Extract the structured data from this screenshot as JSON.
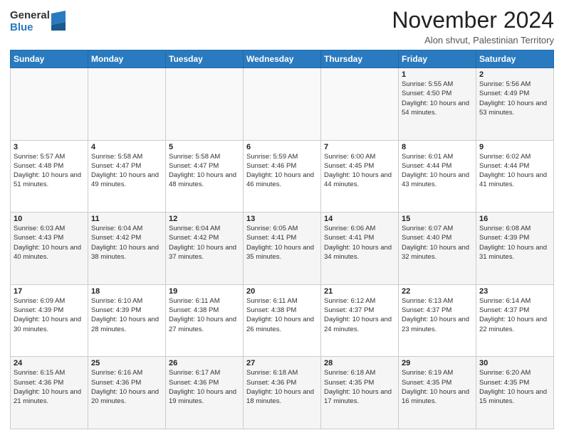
{
  "logo": {
    "general": "General",
    "blue": "Blue"
  },
  "header": {
    "title": "November 2024",
    "subtitle": "Alon shvut, Palestinian Territory"
  },
  "weekdays": [
    "Sunday",
    "Monday",
    "Tuesday",
    "Wednesday",
    "Thursday",
    "Friday",
    "Saturday"
  ],
  "weeks": [
    [
      {
        "day": "",
        "info": ""
      },
      {
        "day": "",
        "info": ""
      },
      {
        "day": "",
        "info": ""
      },
      {
        "day": "",
        "info": ""
      },
      {
        "day": "",
        "info": ""
      },
      {
        "day": "1",
        "info": "Sunrise: 5:55 AM\nSunset: 4:50 PM\nDaylight: 10 hours\nand 54 minutes."
      },
      {
        "day": "2",
        "info": "Sunrise: 5:56 AM\nSunset: 4:49 PM\nDaylight: 10 hours\nand 53 minutes."
      }
    ],
    [
      {
        "day": "3",
        "info": "Sunrise: 5:57 AM\nSunset: 4:48 PM\nDaylight: 10 hours\nand 51 minutes."
      },
      {
        "day": "4",
        "info": "Sunrise: 5:58 AM\nSunset: 4:47 PM\nDaylight: 10 hours\nand 49 minutes."
      },
      {
        "day": "5",
        "info": "Sunrise: 5:58 AM\nSunset: 4:47 PM\nDaylight: 10 hours\nand 48 minutes."
      },
      {
        "day": "6",
        "info": "Sunrise: 5:59 AM\nSunset: 4:46 PM\nDaylight: 10 hours\nand 46 minutes."
      },
      {
        "day": "7",
        "info": "Sunrise: 6:00 AM\nSunset: 4:45 PM\nDaylight: 10 hours\nand 44 minutes."
      },
      {
        "day": "8",
        "info": "Sunrise: 6:01 AM\nSunset: 4:44 PM\nDaylight: 10 hours\nand 43 minutes."
      },
      {
        "day": "9",
        "info": "Sunrise: 6:02 AM\nSunset: 4:44 PM\nDaylight: 10 hours\nand 41 minutes."
      }
    ],
    [
      {
        "day": "10",
        "info": "Sunrise: 6:03 AM\nSunset: 4:43 PM\nDaylight: 10 hours\nand 40 minutes."
      },
      {
        "day": "11",
        "info": "Sunrise: 6:04 AM\nSunset: 4:42 PM\nDaylight: 10 hours\nand 38 minutes."
      },
      {
        "day": "12",
        "info": "Sunrise: 6:04 AM\nSunset: 4:42 PM\nDaylight: 10 hours\nand 37 minutes."
      },
      {
        "day": "13",
        "info": "Sunrise: 6:05 AM\nSunset: 4:41 PM\nDaylight: 10 hours\nand 35 minutes."
      },
      {
        "day": "14",
        "info": "Sunrise: 6:06 AM\nSunset: 4:41 PM\nDaylight: 10 hours\nand 34 minutes."
      },
      {
        "day": "15",
        "info": "Sunrise: 6:07 AM\nSunset: 4:40 PM\nDaylight: 10 hours\nand 32 minutes."
      },
      {
        "day": "16",
        "info": "Sunrise: 6:08 AM\nSunset: 4:39 PM\nDaylight: 10 hours\nand 31 minutes."
      }
    ],
    [
      {
        "day": "17",
        "info": "Sunrise: 6:09 AM\nSunset: 4:39 PM\nDaylight: 10 hours\nand 30 minutes."
      },
      {
        "day": "18",
        "info": "Sunrise: 6:10 AM\nSunset: 4:39 PM\nDaylight: 10 hours\nand 28 minutes."
      },
      {
        "day": "19",
        "info": "Sunrise: 6:11 AM\nSunset: 4:38 PM\nDaylight: 10 hours\nand 27 minutes."
      },
      {
        "day": "20",
        "info": "Sunrise: 6:11 AM\nSunset: 4:38 PM\nDaylight: 10 hours\nand 26 minutes."
      },
      {
        "day": "21",
        "info": "Sunrise: 6:12 AM\nSunset: 4:37 PM\nDaylight: 10 hours\nand 24 minutes."
      },
      {
        "day": "22",
        "info": "Sunrise: 6:13 AM\nSunset: 4:37 PM\nDaylight: 10 hours\nand 23 minutes."
      },
      {
        "day": "23",
        "info": "Sunrise: 6:14 AM\nSunset: 4:37 PM\nDaylight: 10 hours\nand 22 minutes."
      }
    ],
    [
      {
        "day": "24",
        "info": "Sunrise: 6:15 AM\nSunset: 4:36 PM\nDaylight: 10 hours\nand 21 minutes."
      },
      {
        "day": "25",
        "info": "Sunrise: 6:16 AM\nSunset: 4:36 PM\nDaylight: 10 hours\nand 20 minutes."
      },
      {
        "day": "26",
        "info": "Sunrise: 6:17 AM\nSunset: 4:36 PM\nDaylight: 10 hours\nand 19 minutes."
      },
      {
        "day": "27",
        "info": "Sunrise: 6:18 AM\nSunset: 4:36 PM\nDaylight: 10 hours\nand 18 minutes."
      },
      {
        "day": "28",
        "info": "Sunrise: 6:18 AM\nSunset: 4:35 PM\nDaylight: 10 hours\nand 17 minutes."
      },
      {
        "day": "29",
        "info": "Sunrise: 6:19 AM\nSunset: 4:35 PM\nDaylight: 10 hours\nand 16 minutes."
      },
      {
        "day": "30",
        "info": "Sunrise: 6:20 AM\nSunset: 4:35 PM\nDaylight: 10 hours\nand 15 minutes."
      }
    ]
  ]
}
